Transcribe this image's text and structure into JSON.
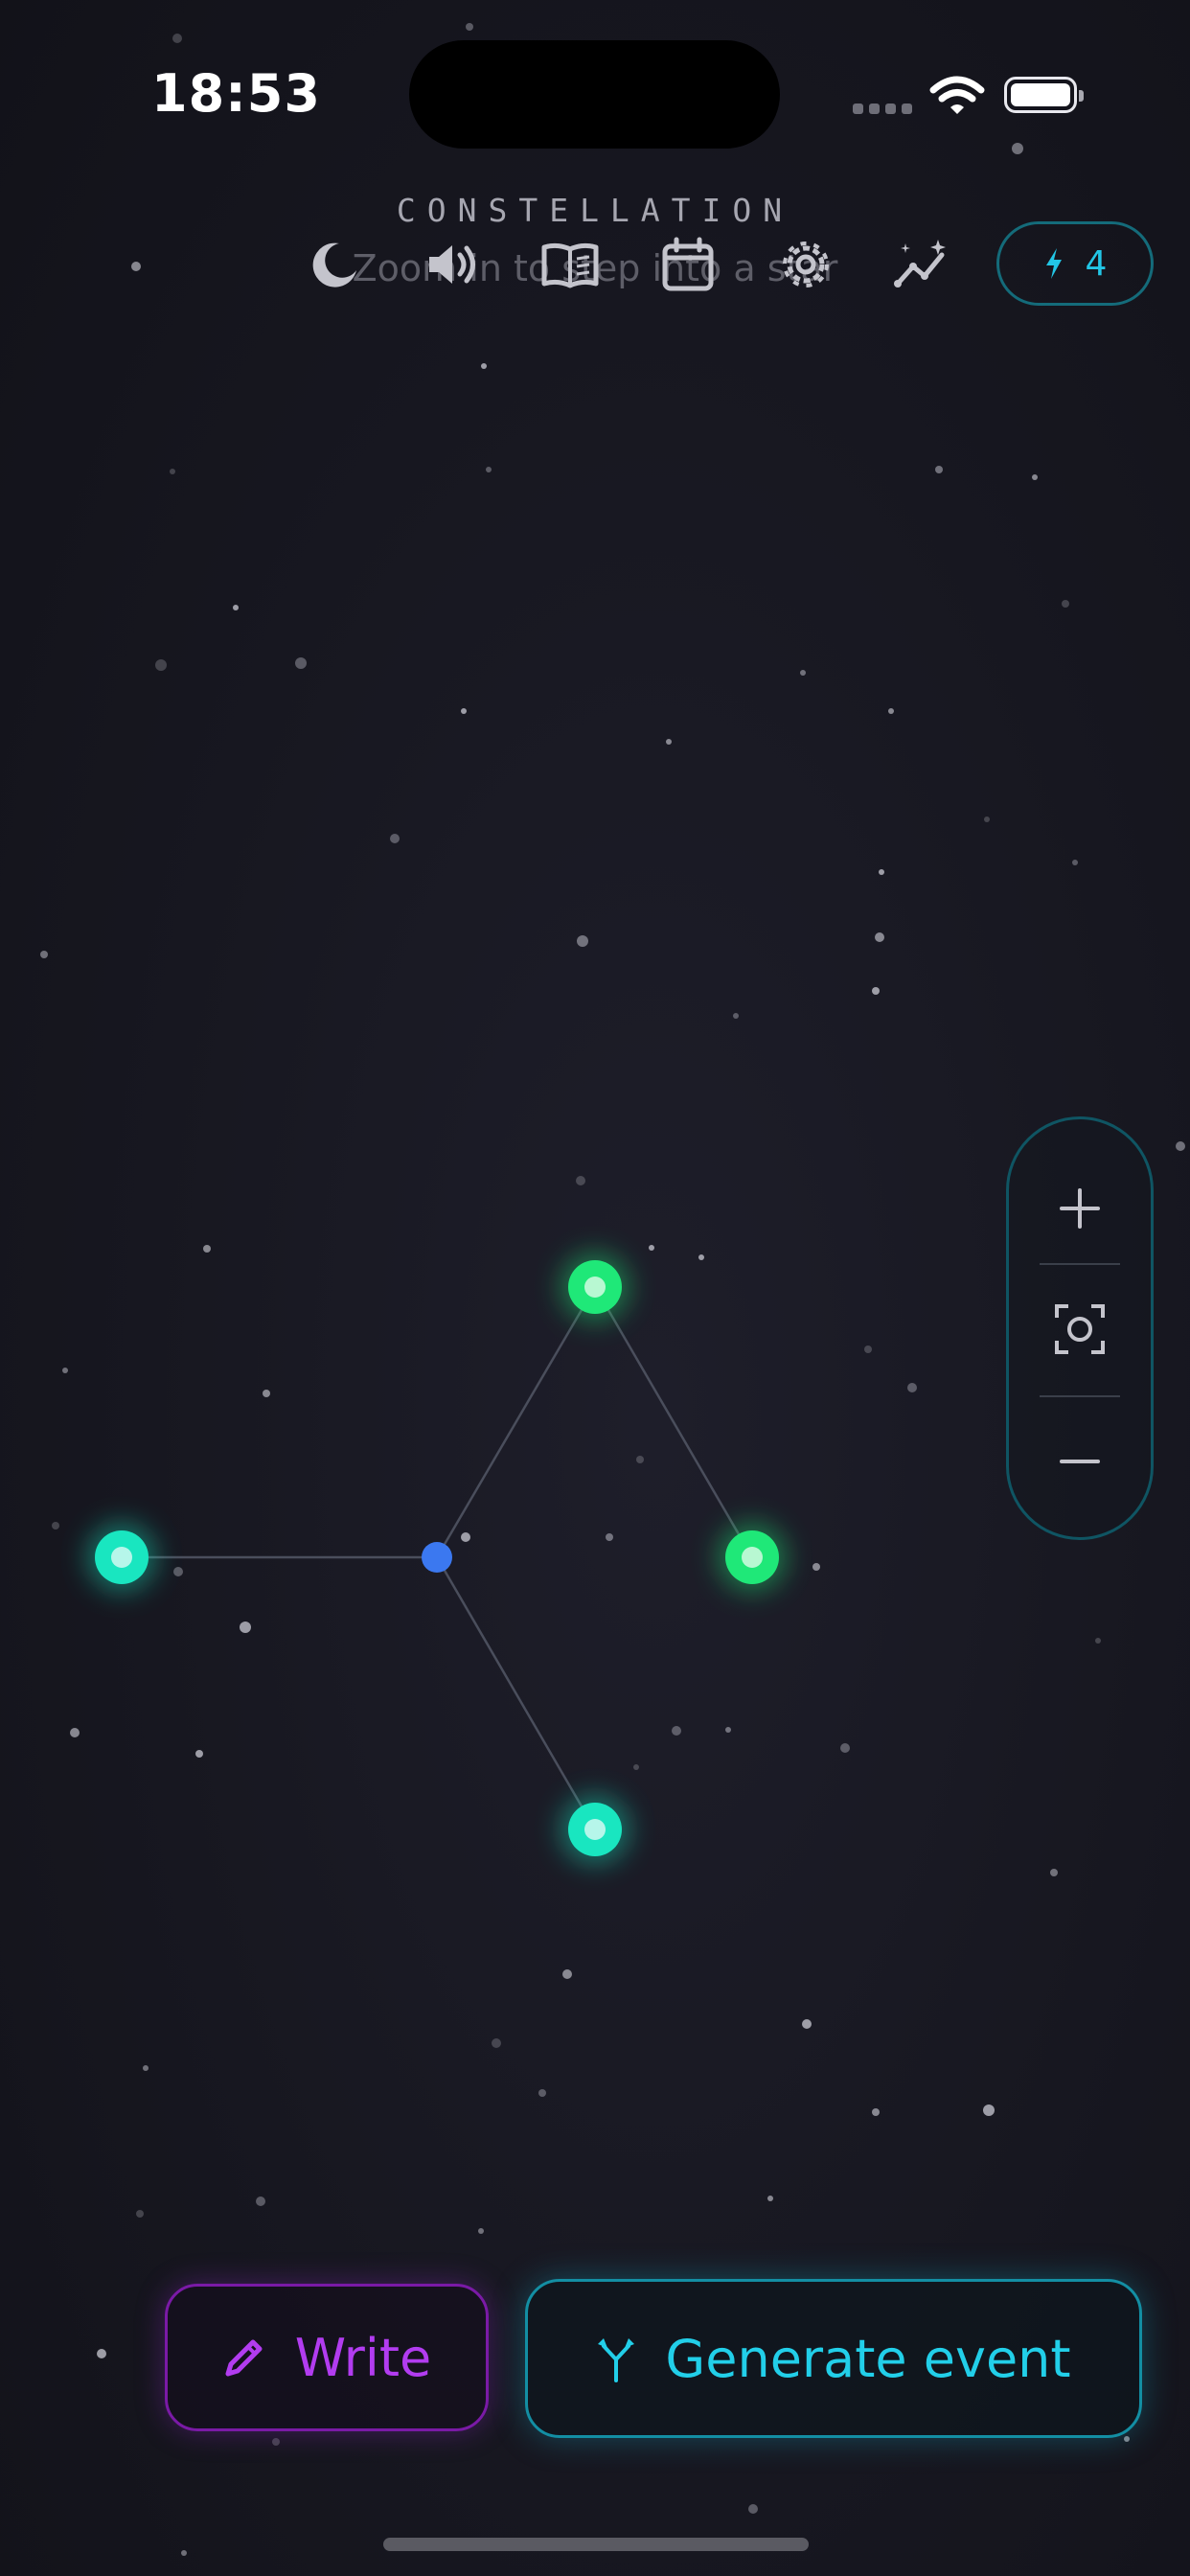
{
  "status_bar": {
    "time": "18:53"
  },
  "header": {
    "title": "CONSTELLATION",
    "subtitle": "Zoom in to step into a star"
  },
  "toolbar": {
    "icons": [
      "moon-icon",
      "speaker-icon",
      "book-icon",
      "calendar-icon",
      "gear-icon",
      "sparkle-chart-icon"
    ],
    "credits_count": "4"
  },
  "zoom_controls": {
    "icons": [
      "plus-icon",
      "focus-icon",
      "minus-icon"
    ]
  },
  "constellation": {
    "node_colors": {
      "center": "#3b78f0",
      "teal": "#19e6c0",
      "green": "#1fe878"
    }
  },
  "actions": {
    "write_label": "Write",
    "generate_label": "Generate event"
  },
  "colors": {
    "accent_cyan": "#22cfe9",
    "accent_purple": "#b23cf0",
    "background": "#171720"
  }
}
